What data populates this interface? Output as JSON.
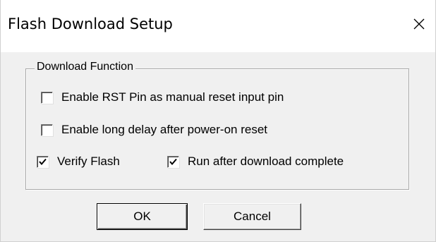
{
  "window": {
    "title": "Flash Download Setup"
  },
  "group": {
    "legend": "Download Function"
  },
  "options": {
    "rst_pin": {
      "label": "Enable RST Pin as manual reset input pin",
      "checked": false
    },
    "long_delay": {
      "label": "Enable long delay after power-on reset",
      "checked": false
    },
    "verify_flash": {
      "label": "Verify Flash",
      "checked": true
    },
    "run_after": {
      "label": "Run after download complete",
      "checked": true
    }
  },
  "buttons": {
    "ok_label": "OK",
    "cancel_label": "Cancel"
  },
  "icons": {
    "close": "close-icon",
    "check": "checkmark-icon"
  }
}
